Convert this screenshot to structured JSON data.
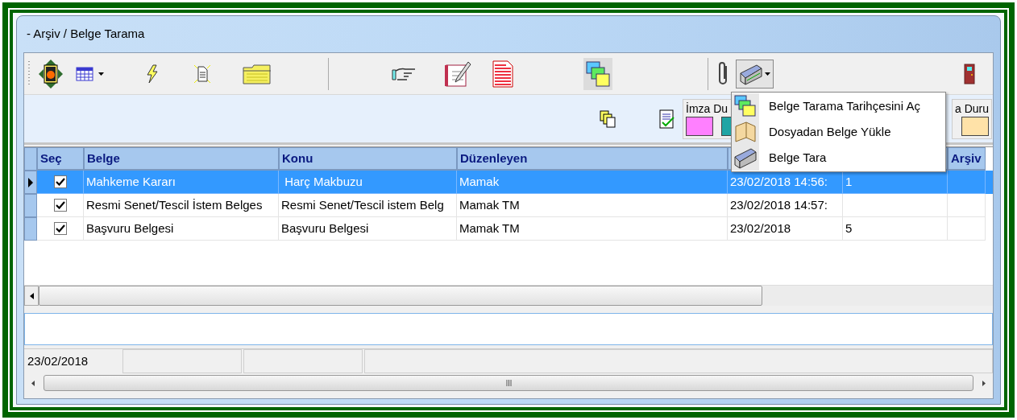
{
  "window": {
    "title": "- Arşiv / Belge Tarama"
  },
  "legend": [
    {
      "label": "İmza Du",
      "swatches": [
        {
          "color": "#ff80ff"
        },
        {
          "color": "#1fa5a5"
        }
      ]
    },
    {
      "label": "a Duru",
      "swatches": [
        {
          "color": "#ffe2a8"
        }
      ]
    }
  ],
  "table": {
    "columns": [
      {
        "label": "Seç"
      },
      {
        "label": "Belge"
      },
      {
        "label": "Konu"
      },
      {
        "label": "Düzenleyen"
      },
      {},
      {},
      {
        "label": "Arşiv"
      }
    ],
    "rows": [
      {
        "selected": true,
        "cells": [
          {
            "kind": "checkbox",
            "checked": true
          },
          {
            "kind": "text",
            "text": "Mahkeme Kararı"
          },
          {
            "kind": "text",
            "text": " Harç Makbuzu"
          },
          {
            "kind": "text",
            "text": "Mamak"
          },
          {
            "kind": "text",
            "text": "23/02/2018 14:56:"
          },
          {
            "kind": "text",
            "text": "1"
          },
          {
            "kind": "empty"
          }
        ]
      },
      {
        "selected": false,
        "cells": [
          {
            "kind": "checkbox",
            "checked": true
          },
          {
            "kind": "text",
            "text": "Resmi Senet/Tescil İstem Belges"
          },
          {
            "kind": "text",
            "text": "Resmi Senet/Tescil istem Belg"
          },
          {
            "kind": "text",
            "text": "Mamak TM"
          },
          {
            "kind": "text",
            "text": "23/02/2018 14:57:"
          },
          {
            "kind": "empty"
          },
          {
            "kind": "empty"
          }
        ]
      },
      {
        "selected": false,
        "cells": [
          {
            "kind": "checkbox",
            "checked": true
          },
          {
            "kind": "text",
            "text": "Başvuru Belgesi"
          },
          {
            "kind": "text",
            "text": "Başvuru Belgesi"
          },
          {
            "kind": "text",
            "text": "Mamak TM"
          },
          {
            "kind": "text",
            "text": "23/02/2018"
          },
          {
            "kind": "text",
            "text": "5"
          },
          {
            "kind": "empty"
          }
        ]
      }
    ]
  },
  "dropdown_menu": {
    "items": [
      {
        "label": "Belge Tarama Tarihçesini Aç",
        "kind": "history"
      },
      {
        "label": "Dosyadan Belge Yükle",
        "kind": "file"
      },
      {
        "label": "Belge Tara",
        "kind": "scan"
      }
    ]
  },
  "status_bar": {
    "date": "23/02/2018"
  }
}
